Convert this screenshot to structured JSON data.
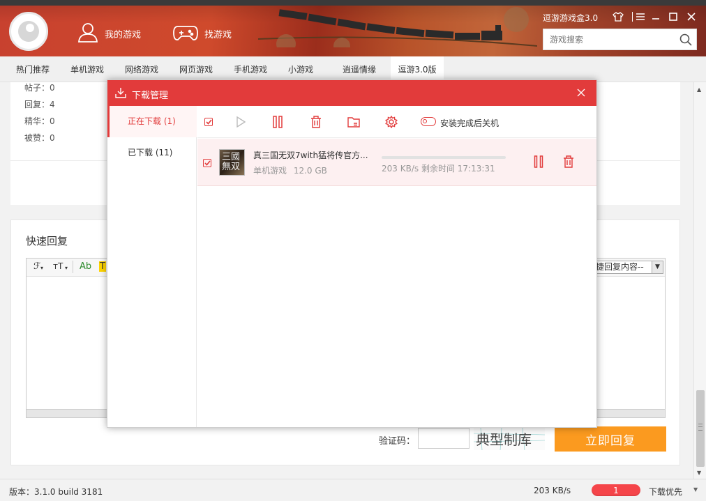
{
  "header": {
    "nav": [
      {
        "label": "我的游戏",
        "icon": "user-icon"
      },
      {
        "label": "找游戏",
        "icon": "gamepad-icon"
      }
    ],
    "app_title": "逗游游戏盒3.0",
    "search": {
      "placeholder": "游戏搜索",
      "icon": "search-icon"
    },
    "window_controls": [
      "skin-icon",
      "menu-icon",
      "minimize-icon",
      "maximize-icon",
      "close-icon"
    ]
  },
  "tabs": [
    {
      "label": "热门推荐"
    },
    {
      "label": "单机游戏"
    },
    {
      "label": "网络游戏"
    },
    {
      "label": "网页游戏"
    },
    {
      "label": "手机游戏"
    },
    {
      "label": "小游戏"
    },
    {
      "label": "逍遥情缘"
    },
    {
      "label": "逗游3.0版",
      "active": true
    }
  ],
  "stats": [
    "帖子：0",
    "回复：4",
    "精华：0",
    "被赞：0"
  ],
  "reply": {
    "title": "快速回复",
    "toolbar": {
      "font": "ℱ",
      "size": "тT",
      "color": "Ab",
      "bg": "T"
    },
    "quick_select": "捷回复内容--",
    "captcha_label": "验证码：",
    "captcha_text": "典型制库",
    "submit": "立即回复"
  },
  "statusbar": {
    "version": "版本：3.1.0 build 3181",
    "speed": "203 KB/s",
    "active_count": "1",
    "priority": "下载优先"
  },
  "dialog": {
    "title": "下载管理",
    "sidebar": [
      {
        "label": "正在下载 (1)",
        "active": true
      },
      {
        "label": "已下载 (11)"
      }
    ],
    "toolbar_icons": [
      "select-all-checkbox",
      "start-icon",
      "pause-icon",
      "delete-icon",
      "folder-icon",
      "settings-icon"
    ],
    "shutdown_label": "安装完成后关机",
    "downloads": [
      {
        "name": "真三国无双7with猛将传官方...",
        "thumb_text": "三國\n無双",
        "category": "单机游戏",
        "size": "12.0 GB",
        "speed": "203 KB/s",
        "remaining": "剩余时间 17:13:31",
        "progress": 0.0
      }
    ]
  },
  "colors": {
    "accent": "#e23b3b",
    "submit": "#fb9a1f",
    "row_bg": "#fdf0f1"
  }
}
